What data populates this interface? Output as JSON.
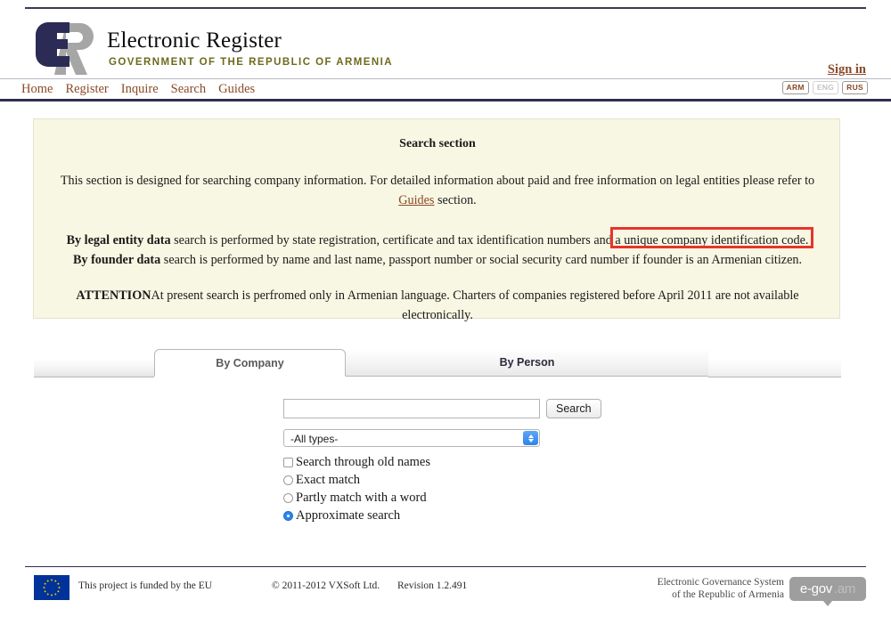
{
  "brand": {
    "title": "Electronic Register",
    "subtitle": "GOVERNMENT OF THE REPUBLIC OF ARMENIA",
    "logo_icon": "er-monogram-logo",
    "logo_navy": "#2b2b55",
    "logo_gray": "#a6a6a6"
  },
  "header": {
    "sign_in": "Sign in"
  },
  "nav": {
    "items": [
      {
        "label": "Home"
      },
      {
        "label": "Register"
      },
      {
        "label": "Inquire"
      },
      {
        "label": "Search"
      },
      {
        "label": "Guides"
      }
    ],
    "languages": [
      {
        "code": "ARM",
        "state": "active"
      },
      {
        "code": "ENG",
        "state": "disabled"
      },
      {
        "code": "RUS",
        "state": "active"
      }
    ],
    "link_color": "#8b4a27",
    "rule_color": "#2e2e52"
  },
  "info_panel": {
    "title": "Search section",
    "paragraph1_before": "This section is designed for searching company information. For detailed information about paid and free information on legal entities please refer to ",
    "paragraph1_link": "Guides",
    "paragraph1_after": " section.",
    "legal_entity_bold": "By legal entity data",
    "legal_entity_rest": " search is performed by state registration, certificate and tax identification numbers and a unique company identification code.",
    "founder_bold": "By founder data",
    "founder_rest": " search is performed by name and last name, passport number or social security card number if founder is an Armenian citizen.",
    "attention_bold": "ATTENTION",
    "attention_rest": "At present search is perfromed only in Armenian language. Charters of companies registered before April 2011 are not available electronically.",
    "background": "#f8f7e3",
    "border": "#e3e2cf"
  },
  "annotation": {
    "label": "a unique company identification code.",
    "color": "#e8342a"
  },
  "tabs": [
    {
      "label": "By Company",
      "active": true
    },
    {
      "label": "By Person",
      "active": false
    }
  ],
  "search_form": {
    "query_value": "",
    "query_placeholder": "",
    "search_button": "Search",
    "type_select_value": "-All types-",
    "options": [
      {
        "kind": "checkbox",
        "label": "Search through old names",
        "checked": false
      },
      {
        "kind": "radio",
        "label": "Exact match",
        "checked": false
      },
      {
        "kind": "radio",
        "label": "Partly match with a word",
        "checked": false
      },
      {
        "kind": "radio",
        "label": "Approximate search",
        "checked": true
      }
    ],
    "accent_color": "#2e84ea"
  },
  "footer": {
    "eu_text": "This project is funded by the EU",
    "copyright": "© 2011-2012 VXSoft Ltd.",
    "revision": "Revision 1.2.491",
    "egov_line1": "Electronic Governance System",
    "egov_line2": "of the Republic of Armenia",
    "egov_badge_main": "e-gov",
    "egov_badge_tld": ".am",
    "eu_flag_icon": "european-union-flag",
    "eu_flag_blue": "#003399",
    "eu_star_yellow": "#ffcc00"
  }
}
